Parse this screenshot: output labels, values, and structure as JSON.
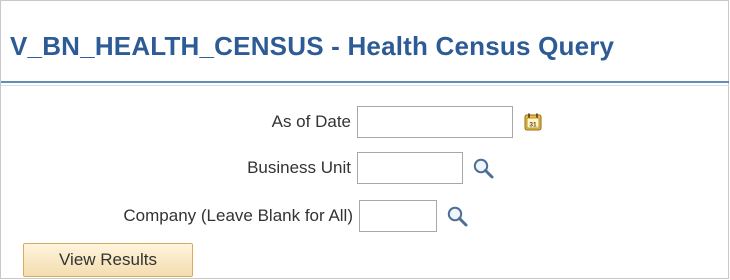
{
  "header": {
    "title": "V_BN_HEALTH_CENSUS - Health Census Query"
  },
  "form": {
    "as_of_date": {
      "label": "As of Date",
      "value": "",
      "icon": "calendar-icon"
    },
    "business_unit": {
      "label": "Business Unit",
      "value": "",
      "icon": "search-icon"
    },
    "company": {
      "label": "Company (Leave Blank for All)",
      "value": "",
      "icon": "search-icon"
    }
  },
  "actions": {
    "view_results_label": "View Results"
  },
  "colors": {
    "title": "#2d5b95",
    "rule": "#4b79a8",
    "button_border": "#d9a95f",
    "button_fill": "#f4ddb0"
  }
}
